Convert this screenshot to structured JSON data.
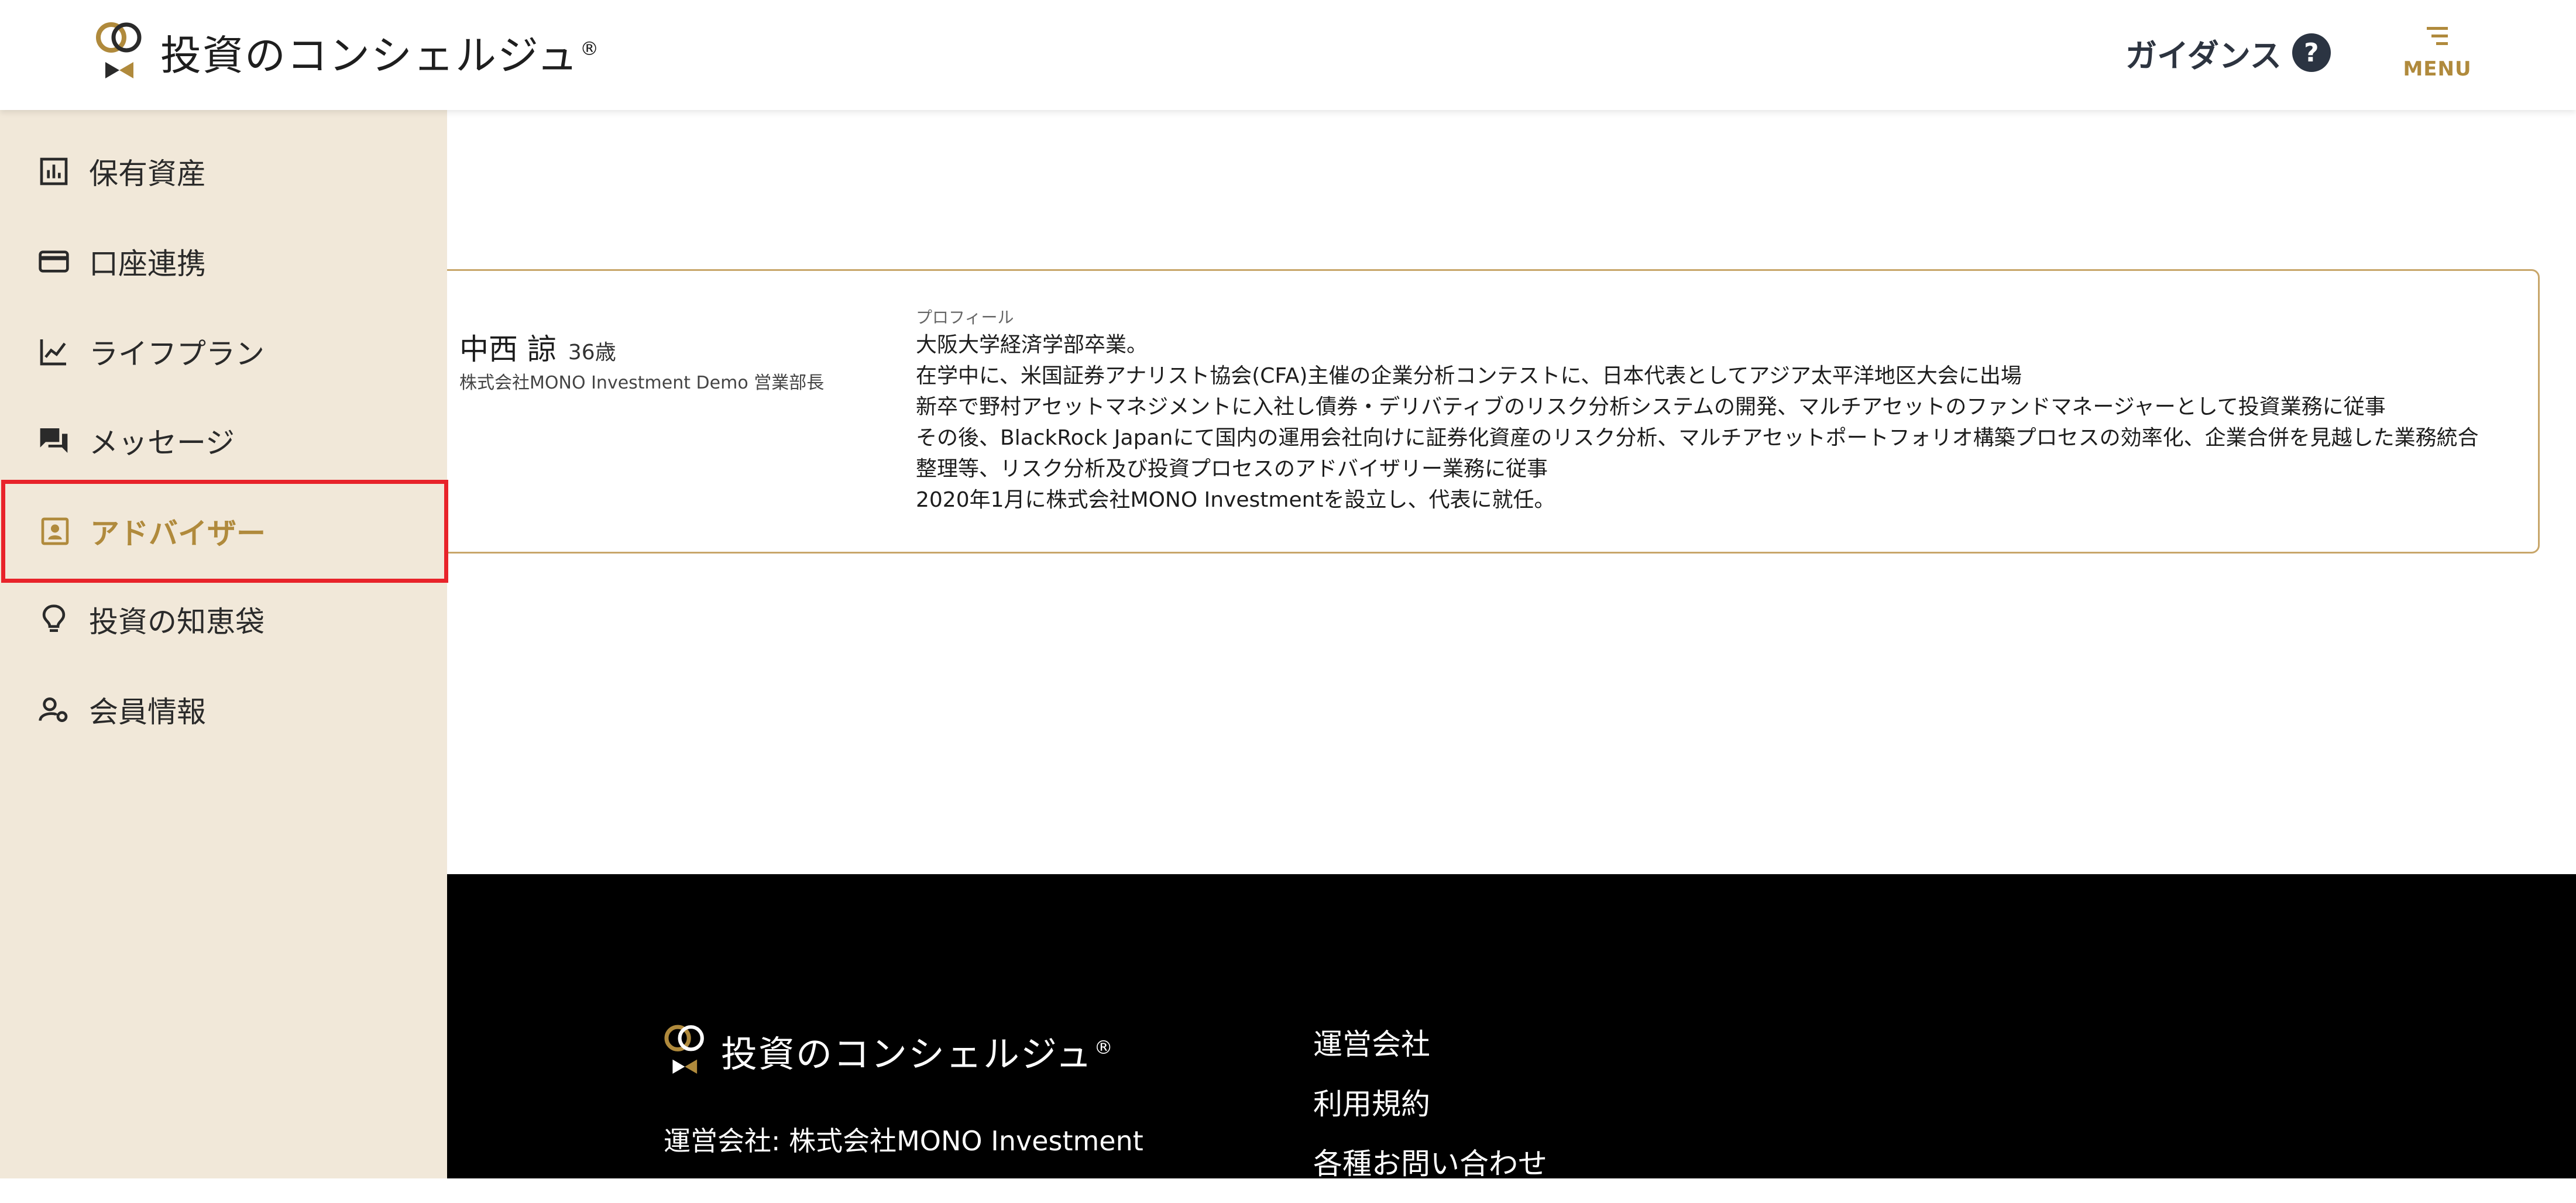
{
  "header": {
    "logo_text": "投資のコンシェルジュ",
    "logo_reg": "®",
    "guidance_label": "ガイダンス",
    "help_symbol": "?",
    "menu_label": "MENU"
  },
  "sidebar": {
    "items": [
      {
        "label": "保有資産",
        "icon": "bar-chart-icon"
      },
      {
        "label": "口座連携",
        "icon": "credit-card-icon"
      },
      {
        "label": "ライフプラン",
        "icon": "trending-up-icon"
      },
      {
        "label": "メッセージ",
        "icon": "chat-bubbles-icon"
      },
      {
        "label": "アドバイザー",
        "icon": "contact-card-icon",
        "active": true
      },
      {
        "label": "投資の知恵袋",
        "icon": "lightbulb-icon"
      },
      {
        "label": "会員情報",
        "icon": "user-settings-icon"
      }
    ]
  },
  "advisor": {
    "name": "中西 諒",
    "age": "36歳",
    "company": "株式会社MONO Investment Demo 営業部長",
    "profile_label": "プロフィール",
    "profile_lines": [
      "大阪大学経済学部卒業。",
      "在学中に、米国証券アナリスト協会(CFA)主催の企業分析コンテストに、日本代表としてアジア太平洋地区大会に出場",
      "新卒で野村アセットマネジメントに入社し債券・デリバティブのリスク分析システムの開発、マルチアセットのファンドマネージャーとして投資業務に従事",
      "その後、BlackRock Japanにて国内の運用会社向けに証券化資産のリスク分析、マルチアセットポートフォリオ構築プロセスの効率化、企業合併を見越した業務統合",
      "整理等、リスク分析及び投資プロセスのアドバイザリー業務に従事",
      "2020年1月に株式会社MONO Investmentを設立し、代表に就任。"
    ]
  },
  "footer": {
    "logo_text": "投資のコンシェルジュ",
    "logo_reg": "®",
    "company": "運営会社: 株式会社MONO Investment",
    "links": [
      "運営会社",
      "利用規約",
      "各種お問い合わせ"
    ]
  },
  "colors": {
    "accent_gold": "#b08a3c",
    "sidebar_bg": "#f1e8d9",
    "highlight_red": "#e8232a",
    "footer_bg": "#000000"
  }
}
